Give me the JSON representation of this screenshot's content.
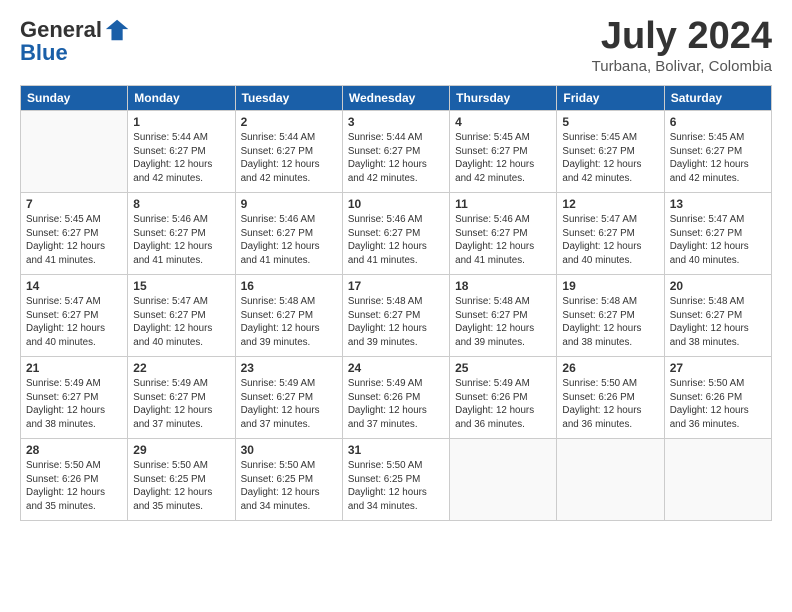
{
  "logo": {
    "line1": "General",
    "line2": "Blue"
  },
  "header": {
    "month": "July 2024",
    "location": "Turbana, Bolivar, Colombia"
  },
  "weekdays": [
    "Sunday",
    "Monday",
    "Tuesday",
    "Wednesday",
    "Thursday",
    "Friday",
    "Saturday"
  ],
  "weeks": [
    [
      {
        "day": "",
        "info": ""
      },
      {
        "day": "1",
        "info": "Sunrise: 5:44 AM\nSunset: 6:27 PM\nDaylight: 12 hours\nand 42 minutes."
      },
      {
        "day": "2",
        "info": "Sunrise: 5:44 AM\nSunset: 6:27 PM\nDaylight: 12 hours\nand 42 minutes."
      },
      {
        "day": "3",
        "info": "Sunrise: 5:44 AM\nSunset: 6:27 PM\nDaylight: 12 hours\nand 42 minutes."
      },
      {
        "day": "4",
        "info": "Sunrise: 5:45 AM\nSunset: 6:27 PM\nDaylight: 12 hours\nand 42 minutes."
      },
      {
        "day": "5",
        "info": "Sunrise: 5:45 AM\nSunset: 6:27 PM\nDaylight: 12 hours\nand 42 minutes."
      },
      {
        "day": "6",
        "info": "Sunrise: 5:45 AM\nSunset: 6:27 PM\nDaylight: 12 hours\nand 42 minutes."
      }
    ],
    [
      {
        "day": "7",
        "info": "Sunrise: 5:45 AM\nSunset: 6:27 PM\nDaylight: 12 hours\nand 41 minutes."
      },
      {
        "day": "8",
        "info": "Sunrise: 5:46 AM\nSunset: 6:27 PM\nDaylight: 12 hours\nand 41 minutes."
      },
      {
        "day": "9",
        "info": "Sunrise: 5:46 AM\nSunset: 6:27 PM\nDaylight: 12 hours\nand 41 minutes."
      },
      {
        "day": "10",
        "info": "Sunrise: 5:46 AM\nSunset: 6:27 PM\nDaylight: 12 hours\nand 41 minutes."
      },
      {
        "day": "11",
        "info": "Sunrise: 5:46 AM\nSunset: 6:27 PM\nDaylight: 12 hours\nand 41 minutes."
      },
      {
        "day": "12",
        "info": "Sunrise: 5:47 AM\nSunset: 6:27 PM\nDaylight: 12 hours\nand 40 minutes."
      },
      {
        "day": "13",
        "info": "Sunrise: 5:47 AM\nSunset: 6:27 PM\nDaylight: 12 hours\nand 40 minutes."
      }
    ],
    [
      {
        "day": "14",
        "info": "Sunrise: 5:47 AM\nSunset: 6:27 PM\nDaylight: 12 hours\nand 40 minutes."
      },
      {
        "day": "15",
        "info": "Sunrise: 5:47 AM\nSunset: 6:27 PM\nDaylight: 12 hours\nand 40 minutes."
      },
      {
        "day": "16",
        "info": "Sunrise: 5:48 AM\nSunset: 6:27 PM\nDaylight: 12 hours\nand 39 minutes."
      },
      {
        "day": "17",
        "info": "Sunrise: 5:48 AM\nSunset: 6:27 PM\nDaylight: 12 hours\nand 39 minutes."
      },
      {
        "day": "18",
        "info": "Sunrise: 5:48 AM\nSunset: 6:27 PM\nDaylight: 12 hours\nand 39 minutes."
      },
      {
        "day": "19",
        "info": "Sunrise: 5:48 AM\nSunset: 6:27 PM\nDaylight: 12 hours\nand 38 minutes."
      },
      {
        "day": "20",
        "info": "Sunrise: 5:48 AM\nSunset: 6:27 PM\nDaylight: 12 hours\nand 38 minutes."
      }
    ],
    [
      {
        "day": "21",
        "info": "Sunrise: 5:49 AM\nSunset: 6:27 PM\nDaylight: 12 hours\nand 38 minutes."
      },
      {
        "day": "22",
        "info": "Sunrise: 5:49 AM\nSunset: 6:27 PM\nDaylight: 12 hours\nand 37 minutes."
      },
      {
        "day": "23",
        "info": "Sunrise: 5:49 AM\nSunset: 6:27 PM\nDaylight: 12 hours\nand 37 minutes."
      },
      {
        "day": "24",
        "info": "Sunrise: 5:49 AM\nSunset: 6:26 PM\nDaylight: 12 hours\nand 37 minutes."
      },
      {
        "day": "25",
        "info": "Sunrise: 5:49 AM\nSunset: 6:26 PM\nDaylight: 12 hours\nand 36 minutes."
      },
      {
        "day": "26",
        "info": "Sunrise: 5:50 AM\nSunset: 6:26 PM\nDaylight: 12 hours\nand 36 minutes."
      },
      {
        "day": "27",
        "info": "Sunrise: 5:50 AM\nSunset: 6:26 PM\nDaylight: 12 hours\nand 36 minutes."
      }
    ],
    [
      {
        "day": "28",
        "info": "Sunrise: 5:50 AM\nSunset: 6:26 PM\nDaylight: 12 hours\nand 35 minutes."
      },
      {
        "day": "29",
        "info": "Sunrise: 5:50 AM\nSunset: 6:25 PM\nDaylight: 12 hours\nand 35 minutes."
      },
      {
        "day": "30",
        "info": "Sunrise: 5:50 AM\nSunset: 6:25 PM\nDaylight: 12 hours\nand 34 minutes."
      },
      {
        "day": "31",
        "info": "Sunrise: 5:50 AM\nSunset: 6:25 PM\nDaylight: 12 hours\nand 34 minutes."
      },
      {
        "day": "",
        "info": ""
      },
      {
        "day": "",
        "info": ""
      },
      {
        "day": "",
        "info": ""
      }
    ]
  ]
}
